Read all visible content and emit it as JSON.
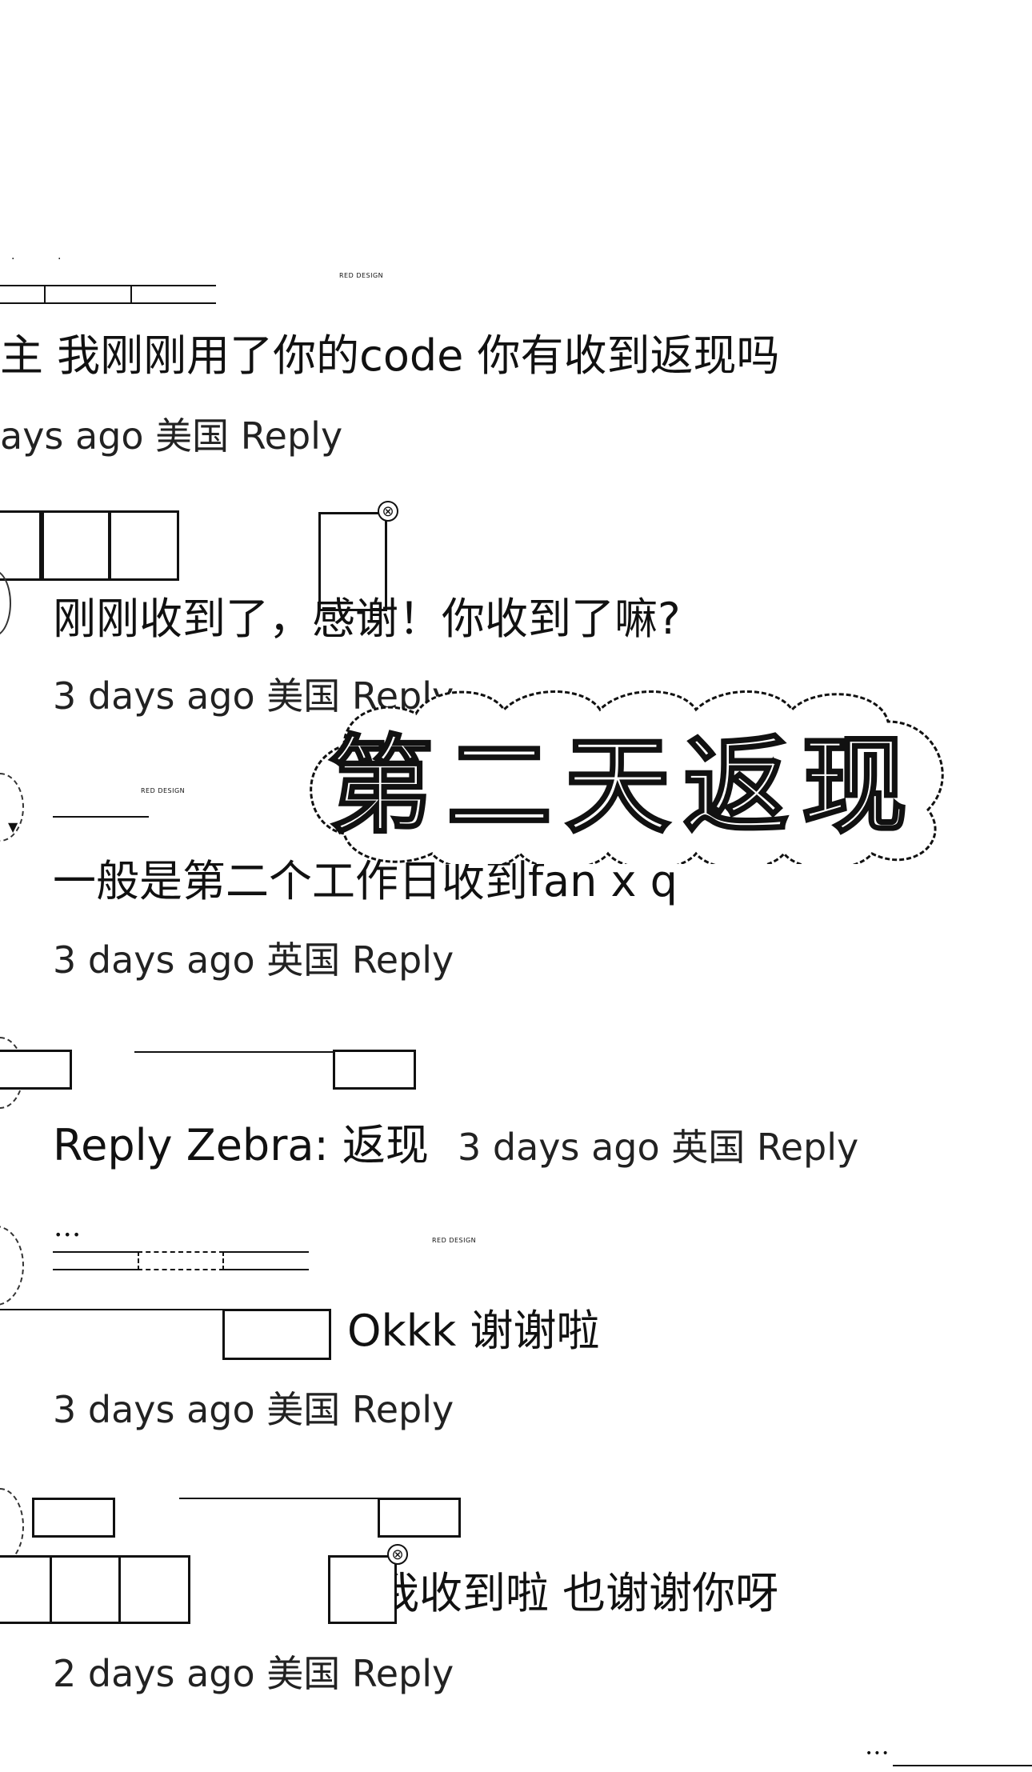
{
  "comments": [
    {
      "text": "主 我刚刚用了你的code 你有收到返现吗",
      "meta": "ays ago 美国 Reply"
    },
    {
      "text": "刚刚收到了，感谢！你收到了嘛?",
      "meta": "3 days ago 美国 Reply"
    },
    {
      "text": "一般是第二个工作日收到fan x q",
      "meta": "3 days ago 英国 Reply"
    },
    {
      "text": "Reply Zebra: 返现",
      "meta": "3 days ago 英国 Reply"
    },
    {
      "text": "Okkk 谢谢啦",
      "meta": "3 days ago 美国 Reply"
    },
    {
      "text": "我收到啦 也谢谢你呀",
      "meta": "2 days ago 美国 Reply"
    }
  ],
  "sticker": {
    "text": "第二天返现"
  },
  "labels": {
    "red_design": "RED DESIGN",
    "more": "•••"
  },
  "colors": {
    "background": "#ffffff",
    "text": "#111111"
  }
}
